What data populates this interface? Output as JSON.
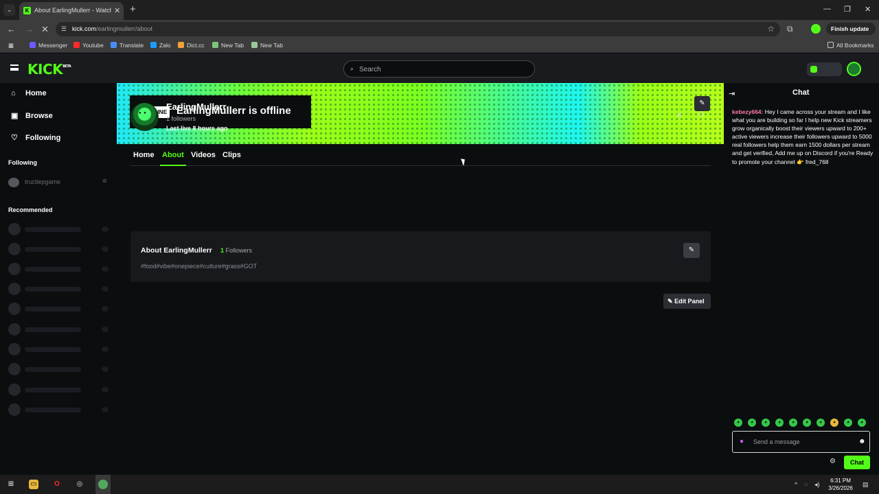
{
  "browser": {
    "tab_title": "About EarlingMullerr - Watch L",
    "tab_close": "✕",
    "new_tab": "+",
    "url_host": "kick.com",
    "url_path": "/earlingmullerr/about",
    "finish_update": "Finish update",
    "bookmarks": [
      {
        "label": "Messenger",
        "color": "#6c5cff"
      },
      {
        "label": "Youtube",
        "color": "#ff2a2a"
      },
      {
        "label": "Translate",
        "color": "#4a8cff"
      },
      {
        "label": "Zalo",
        "color": "#1e9bff"
      },
      {
        "label": "Dict.cc",
        "color": "#f2a23a"
      },
      {
        "label": "New Tab",
        "color": "#7cc47c"
      },
      {
        "label": "New Tab",
        "color": "#9ac79a"
      }
    ],
    "all_bookmarks": "All Bookmarks"
  },
  "header": {
    "logo": "KICK",
    "logo_badge": "BETA",
    "search_placeholder": "Search"
  },
  "sidebar": {
    "nav": [
      {
        "label": "Home",
        "icon": "home-icon",
        "glyph": "⌂"
      },
      {
        "label": "Browse",
        "icon": "browse-icon",
        "glyph": "▣"
      },
      {
        "label": "Following",
        "icon": "heart-icon",
        "glyph": "♡"
      }
    ],
    "following_heading": "Following",
    "following": [
      {
        "name": "tructiepgame"
      }
    ],
    "recommended_heading": "Recommended"
  },
  "banner": {
    "offline_badge": "OFFLINE",
    "offline_text": "EarlingMullerr is offline"
  },
  "channel": {
    "name": "EarlingMullerr",
    "followers": "1 followers",
    "last_live": "Last live 8 hours ago",
    "tabs": [
      "Home",
      "About",
      "Videos",
      "Clips"
    ],
    "active_tab": "About"
  },
  "about": {
    "title": "About EarlingMullerr",
    "followers_count": "1",
    "followers_label": "Followers",
    "tags": "#food#vibe#onepiece#culture#grass#GOT",
    "edit_panel": "Edit Panel"
  },
  "chat": {
    "title": "Chat",
    "message_user": "kebezy664:",
    "message_text": "Hey I came across your stream and I like what you are building so far I help new Kick streamers grow organically boost their viewers upward to 200+ active viewers increase their followers upward to 5000 real followers help them earn 1500 dollars per stream and get verified, Add me up on Discord if you're Ready to promote your channel 👉 fred_768",
    "input_placeholder": "Send a message",
    "send_label": "Chat"
  },
  "taskbar": {
    "time": "6:31 PM",
    "date": "3/26/2026"
  },
  "colors": {
    "accent": "#53fc18",
    "chat_user": "#ff7ca7"
  }
}
